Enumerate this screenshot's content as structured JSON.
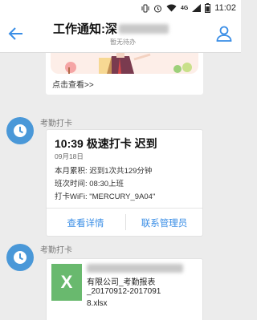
{
  "status_bar": {
    "network_label": "4G",
    "time": "11:02",
    "icons": [
      "vibrate-icon",
      "alarm-icon",
      "wifi-icon",
      "cellular-signal-icon",
      "battery-icon"
    ]
  },
  "header": {
    "title_prefix": "工作通知:深",
    "subtitle": "暂无待办",
    "icons": [
      "back-arrow-icon",
      "contact-icon"
    ]
  },
  "previous_message": {
    "link": "点击查看>>"
  },
  "messages": [
    {
      "sender": "考勤打卡",
      "card": {
        "title": "10:39 极速打卡 迟到",
        "date": "09月18日",
        "lines": [
          "本月累积: 迟到1次共129分钟",
          "班次时间: 08:30上班",
          "打卡WiFi: \"MERCURY_9A04\""
        ],
        "button_left": "查看详情",
        "button_right": "联系管理员"
      }
    },
    {
      "sender": "考勤打卡",
      "file": {
        "icon_letter": "X",
        "name_lines": [
          "有限公司_考勤报表",
          "_20170912-2017091",
          "8.xlsx"
        ]
      }
    }
  ],
  "colors": {
    "accent": "#3a8ee6",
    "avatar": "#4a98d8",
    "excel_green": "#69b96e",
    "background": "#ececec"
  }
}
